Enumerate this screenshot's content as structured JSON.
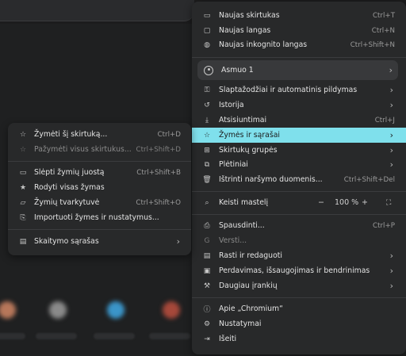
{
  "main_menu": {
    "new_tab": {
      "label": "Naujas skirtukas",
      "shortcut": "Ctrl+T"
    },
    "new_window": {
      "label": "Naujas langas",
      "shortcut": "Ctrl+N"
    },
    "new_incognito": {
      "label": "Naujas inkognito langas",
      "shortcut": "Ctrl+Shift+N"
    },
    "profile": {
      "label": "Asmuo 1"
    },
    "passwords": {
      "label": "Slaptažodžiai ir automatinis pildymas"
    },
    "history": {
      "label": "Istorija"
    },
    "downloads": {
      "label": "Atsisiuntimai",
      "shortcut": "Ctrl+J"
    },
    "bookmarks": {
      "label": "Žymės ir sąrašai"
    },
    "tab_groups": {
      "label": "Skirtukų grupės"
    },
    "extensions": {
      "label": "Plėtiniai"
    },
    "clear_data": {
      "label": "Ištrinti naršymo duomenis...",
      "shortcut": "Ctrl+Shift+Del"
    },
    "zoom": {
      "label": "Keisti mastelį",
      "minus": "−",
      "value": "100 %",
      "plus": "+"
    },
    "print": {
      "label": "Spausdinti...",
      "shortcut": "Ctrl+P"
    },
    "translate": {
      "label": "Versti..."
    },
    "find_edit": {
      "label": "Rasti ir redaguoti"
    },
    "cast_save": {
      "label": "Perdavimas, išsaugojimas ir bendrinimas"
    },
    "more_tools": {
      "label": "Daugiau įrankių"
    },
    "about": {
      "label": "Apie „Chromium“"
    },
    "settings": {
      "label": "Nustatymai"
    },
    "exit": {
      "label": "Išeiti"
    }
  },
  "bookmarks_submenu": {
    "bookmark_tab": {
      "label": "Žymėti šį skirtuką...",
      "shortcut": "Ctrl+D"
    },
    "bookmark_all": {
      "label": "Pažymėti visus skirtukus...",
      "shortcut": "Ctrl+Shift+D"
    },
    "hide_bar": {
      "label": "Slėpti žymių juostą",
      "shortcut": "Ctrl+Shift+B"
    },
    "show_all": {
      "label": "Rodyti visas žymas"
    },
    "manager": {
      "label": "Žymių tvarkytuvė",
      "shortcut": "Ctrl+Shift+O"
    },
    "import": {
      "label": "Importuoti žymes ir nustatymus..."
    },
    "reading_list": {
      "label": "Skaitymo sąrašas"
    }
  },
  "colors": {
    "highlight": "#7fe0ec",
    "menu_bg": "#28292a"
  }
}
